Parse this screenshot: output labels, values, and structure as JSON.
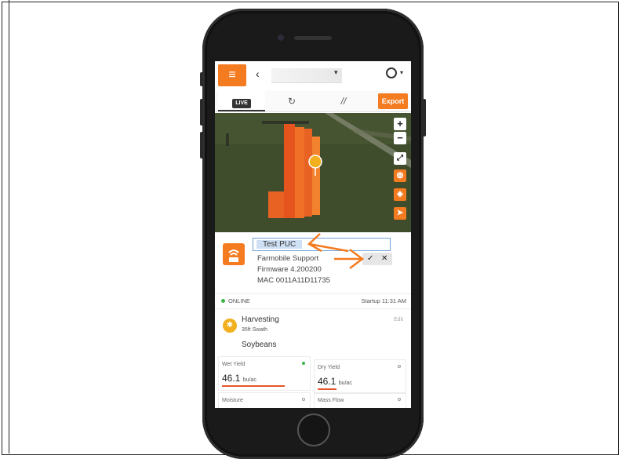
{
  "header": {
    "menu_glyph": "≡",
    "back_glyph": "‹",
    "caret_glyph": "▾"
  },
  "tabs": [
    {
      "label": "LIVE",
      "icon": "live-badge"
    },
    {
      "label": "↻",
      "icon": "history-icon"
    },
    {
      "label": "//",
      "icon": "coverage-icon"
    }
  ],
  "export_label": "Export",
  "map_controls": [
    "+",
    "−"
  ],
  "device": {
    "name_value": "Test PUC",
    "owner": "Farmobile Support",
    "firmware": "Firmware 4.200200",
    "mac": "MAC 0011A11D11735",
    "confirm_glyph": "✓",
    "cancel_glyph": "✕"
  },
  "status": {
    "text": "ONLINE",
    "startup": "Startup 11:31 AM"
  },
  "activity": {
    "title": "Harvesting",
    "detail": "35ft Swath",
    "edit": "Edit",
    "crop": "Soybeans"
  },
  "cards": [
    {
      "label": "Wet Yield",
      "value": "46.1",
      "unit": "bu/ac",
      "indicator_color": "#3cb44b"
    },
    {
      "label": "Dry Yield",
      "value": "46.1",
      "unit": "bu/ac",
      "indicator_color": "#ffffff"
    },
    {
      "label": "Moisture",
      "value": "",
      "unit": "",
      "indicator_color": "#ffffff"
    },
    {
      "label": "Mass Flow",
      "value": "",
      "unit": "",
      "indicator_color": "#ffffff"
    }
  ],
  "colors": {
    "accent": "#f47b20",
    "online": "#3cb44b",
    "annotation": "#f47b20"
  }
}
